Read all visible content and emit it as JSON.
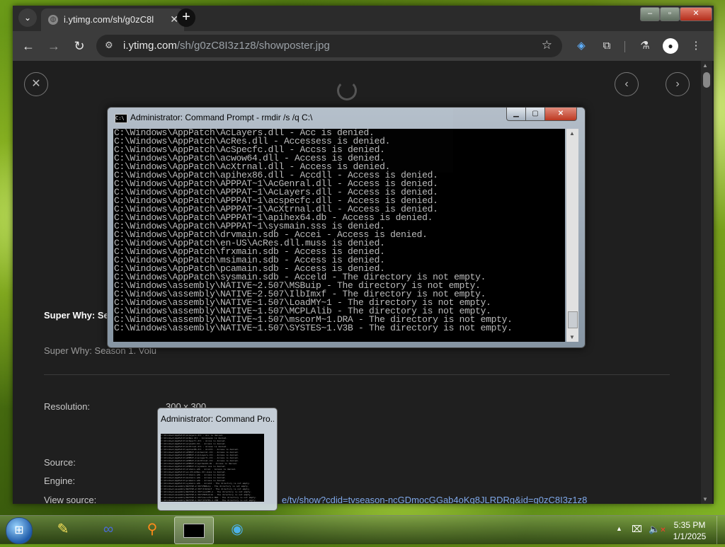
{
  "browser": {
    "tab": {
      "title": "i.ytimg.com/sh/g0zC8l"
    },
    "url": {
      "host": "i.ytimg.com",
      "path": "/sh/g0zC8I3z1z8/showposter.jpg"
    }
  },
  "viewer": {
    "title": "Super Why: Se",
    "subtitle": "Super Why: Season 1. Volu",
    "resolution_label": "Resolution:",
    "resolution_value": "300 x 300",
    "source_label": "Source:",
    "engine_label": "Engine:",
    "view_source_label": "View source:",
    "view_source_link": "e/tv/show?cdid=tvseason-ncGDmocGGab4oKq8JLRDRg&id=g0zC8I3z1z8"
  },
  "cmd": {
    "title": "Administrator:  Command Prompt - rmdir  /s /q C:\\",
    "lines": [
      "C:\\Windows\\AppPatch\\AcLayers.dll - Acc is denied.",
      "C:\\Windows\\AppPatch\\AcRes.dll - Accessess is denied.",
      "C:\\Windows\\AppPatch\\AcSpecfc.dll - Accss is denied.",
      "C:\\Windows\\AppPatch\\acwow64.dll - Access is denied.",
      "C:\\Windows\\AppPatch\\AcXtrnal.dll - Access is denied.",
      "C:\\Windows\\AppPatch\\apihex86.dll - Accdll - Access is denied.",
      "C:\\Windows\\AppPatch\\APPPAT~1\\AcGenral.dll - Access is denied.",
      "C:\\Windows\\AppPatch\\APPPAT~1\\AcLayers.dll - Access is denied.",
      "C:\\Windows\\AppPatch\\APPPAT~1\\acspecfc.dll - Access is denied.",
      "C:\\Windows\\AppPatch\\APPPAT~1\\AcXtrnal.dll - Access is denied.",
      "C:\\Windows\\AppPatch\\APPPAT~1\\apihex64.db - Access is denied.",
      "C:\\Windows\\AppPatch\\APPPAT~1\\sysmain.sss is denied.",
      "C:\\Windows\\AppPatch\\drvmain.sdb - Accei - Access is denied.",
      "C:\\Windows\\AppPatch\\en-US\\AcRes.dll.muss is denied.",
      "C:\\Windows\\AppPatch\\frxmain.sdb - Access is denied.",
      "C:\\Windows\\AppPatch\\msimain.sdb - Access is denied.",
      "C:\\Windows\\AppPatch\\pcamain.sdb - Access is denied.",
      "C:\\Windows\\AppPatch\\sysmain.sdb - Acceld - The directory is not empty.",
      "C:\\Windows\\assembly\\NATIVE~2.507\\MSBuip - The directory is not empty.",
      "C:\\Windows\\assembly\\NATIVE~2.507\\IlbImxf - The directory is not empty.",
      "C:\\Windows\\assembly\\NATIVE~1.507\\LoadMY~1 - The directory is not empty.",
      "C:\\Windows\\assembly\\NATIVE~1.507\\MCPLAlib - The directory is not empty.",
      "C:\\Windows\\assembly\\NATIVE~1.507\\mscorM~1.DRA - The directory is not empty.",
      "C:\\Windows\\assembly\\NATIVE~1.507\\SYSTES~1.V3B - The directory is not empty."
    ]
  },
  "preview": {
    "title": "Administrator:  Command Pro..."
  },
  "taskbar": {
    "time": "5:35 PM",
    "date": "1/1/2025"
  }
}
